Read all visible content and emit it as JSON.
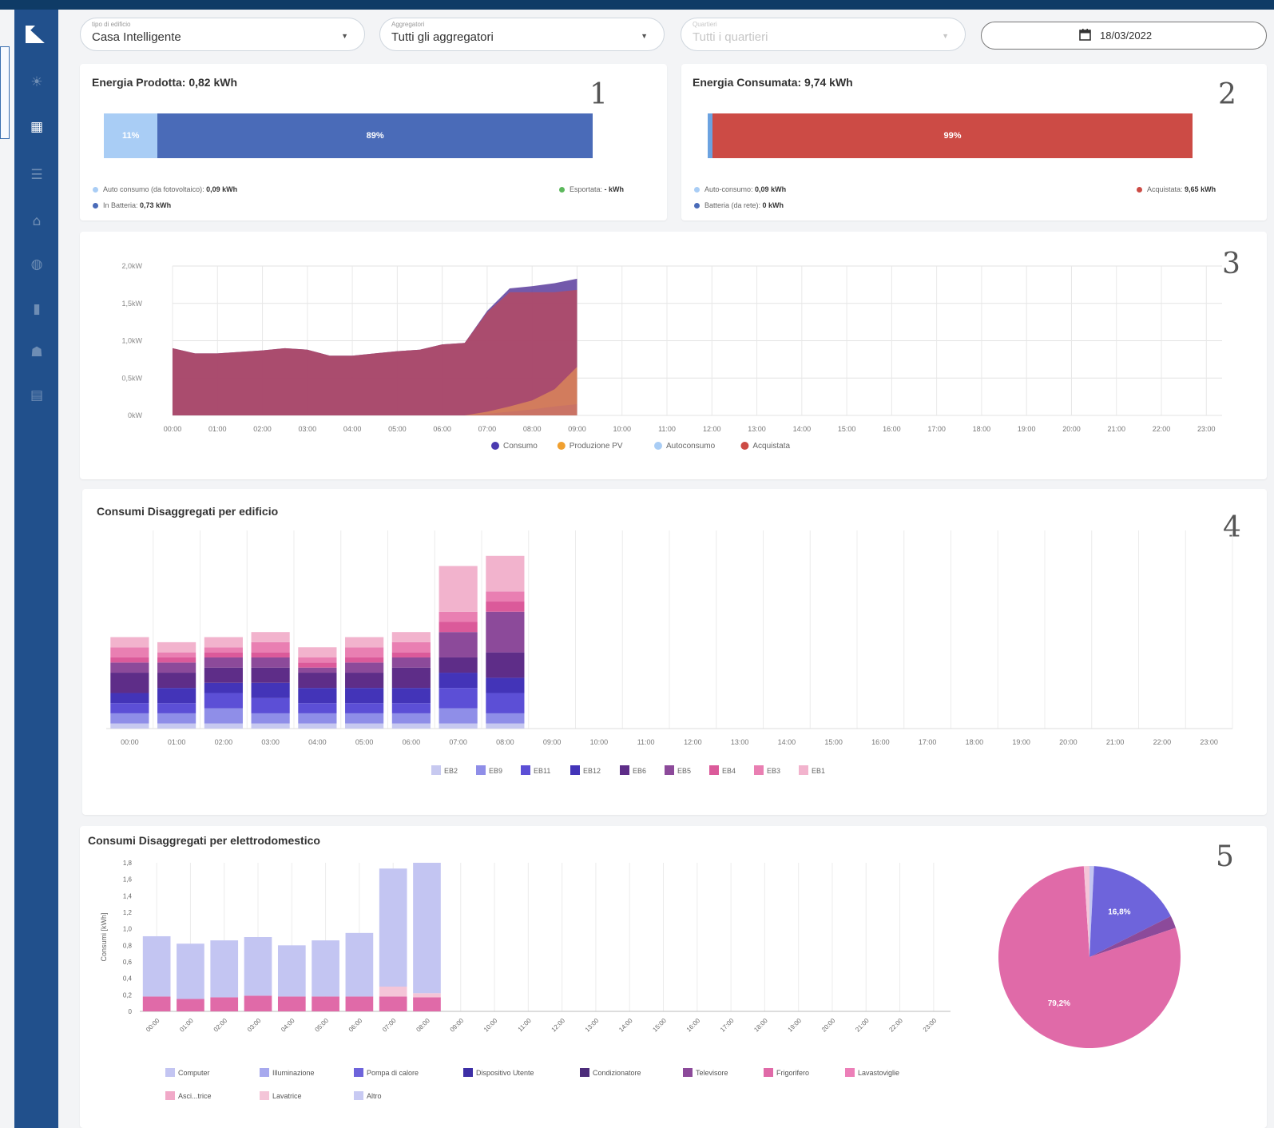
{
  "filters": {
    "building_type": {
      "label": "tipo di edificio",
      "value": "Casa Intelligente"
    },
    "aggregators": {
      "label": "Aggregatori",
      "value": "Tutti gli aggregatori"
    },
    "districts": {
      "label": "Quartieri",
      "value": "Tutti i quartieri"
    },
    "date": "18/03/2022"
  },
  "produced": {
    "title": "Energia Prodotta: 0,82 kWh",
    "number": "1",
    "bar": [
      {
        "label": "11%",
        "fraction": 0.11,
        "color": "#a9cdf5"
      },
      {
        "label": "89%",
        "fraction": 0.89,
        "color": "#4a6bb8"
      }
    ],
    "legend_self_label": "Auto consumo (da fotovoltaico):",
    "legend_self_value": "0,09 kWh",
    "legend_battery_label": "In Batteria:",
    "legend_battery_value": "0,73 kWh",
    "legend_exported_label": "Esportata:",
    "legend_exported_value": "- kWh",
    "colors": {
      "self": "#a9cdf5",
      "battery": "#4a6bb8",
      "exported": "#5cb85c"
    }
  },
  "consumed": {
    "title": "Energia Consumata: 9,74 kWh",
    "number": "2",
    "bar": [
      {
        "label": "",
        "fraction": 0.01,
        "color": "#6ba2e0"
      },
      {
        "label": "99%",
        "fraction": 0.99,
        "color": "#cc4b45"
      }
    ],
    "legend_self_label": "Auto-consumo:",
    "legend_self_value": "0,09 kWh",
    "legend_battery_label": "Batteria (da rete):",
    "legend_battery_value": "0 kWh",
    "legend_bought_label": "Acquistata:",
    "legend_bought_value": "9,65 kWh",
    "colors": {
      "self": "#a9cdf5",
      "battery": "#4a6bb8",
      "bought": "#cc4b45"
    }
  },
  "power_chart": {
    "number": "3",
    "chart_data": {
      "type": "area",
      "x": [
        "00:00",
        "01:00",
        "02:00",
        "03:00",
        "04:00",
        "05:00",
        "06:00",
        "07:00",
        "08:00",
        "09:00",
        "10:00",
        "11:00",
        "12:00",
        "13:00",
        "14:00",
        "15:00",
        "16:00",
        "17:00",
        "18:00",
        "19:00",
        "20:00",
        "21:00",
        "22:00",
        "23:00"
      ],
      "y_ticks": [
        "0kW",
        "0,5kW",
        "1,0kW",
        "1,5kW",
        "2,0kW"
      ],
      "ylim": [
        0,
        2.0
      ],
      "series": [
        {
          "name": "Consumo",
          "color": "#4b3bb0",
          "values": [
            0.9,
            0.83,
            0.83,
            0.85,
            0.87,
            0.9,
            0.88,
            0.8,
            0.8,
            0.83,
            0.86,
            0.88,
            0.95,
            0.97,
            1.4,
            1.7,
            1.73,
            1.77,
            1.83
          ]
        },
        {
          "name": "Produzione PV",
          "color": "#f0a030",
          "values": [
            0,
            0,
            0,
            0,
            0,
            0,
            0,
            0,
            0,
            0,
            0,
            0,
            0,
            0,
            0.05,
            0.12,
            0.2,
            0.35,
            0.65
          ]
        },
        {
          "name": "Autoconsumo",
          "color": "#a9cdf5",
          "values": [
            0,
            0,
            0,
            0,
            0,
            0,
            0,
            0,
            0,
            0,
            0,
            0,
            0,
            0,
            0.02,
            0.05,
            0.08,
            0.12,
            0.15
          ]
        },
        {
          "name": "Acquistata",
          "color": "#cc4b45",
          "values": [
            0.9,
            0.83,
            0.83,
            0.85,
            0.87,
            0.9,
            0.88,
            0.8,
            0.8,
            0.83,
            0.86,
            0.88,
            0.95,
            0.97,
            1.38,
            1.65,
            1.65,
            1.65,
            1.68
          ]
        }
      ],
      "x_step_hours": 0.5
    }
  },
  "buildings_chart": {
    "title": "Consumi Disaggregati per edificio",
    "number": "4",
    "chart_data": {
      "type": "bar",
      "categories": [
        "00:00",
        "01:00",
        "02:00",
        "03:00",
        "04:00",
        "05:00",
        "06:00",
        "07:00",
        "08:00",
        "09:00",
        "10:00",
        "11:00",
        "12:00",
        "13:00",
        "14:00",
        "15:00",
        "16:00",
        "17:00",
        "18:00",
        "19:00",
        "20:00",
        "21:00",
        "22:00",
        "23:00"
      ],
      "stacked": true,
      "series": [
        {
          "name": "EB2",
          "color": "#c7c9f0",
          "values": [
            0.05,
            0.05,
            0.05,
            0.05,
            0.05,
            0.05,
            0.05,
            0.05,
            0.05
          ]
        },
        {
          "name": "EB9",
          "color": "#8f8ee8",
          "values": [
            0.1,
            0.1,
            0.15,
            0.1,
            0.1,
            0.1,
            0.1,
            0.15,
            0.1
          ]
        },
        {
          "name": "EB11",
          "color": "#5c4fd6",
          "values": [
            0.1,
            0.1,
            0.15,
            0.15,
            0.1,
            0.1,
            0.1,
            0.2,
            0.2
          ]
        },
        {
          "name": "EB12",
          "color": "#4334b8",
          "values": [
            0.1,
            0.15,
            0.1,
            0.15,
            0.15,
            0.15,
            0.15,
            0.15,
            0.15
          ]
        },
        {
          "name": "EB6",
          "color": "#5e2d88",
          "values": [
            0.2,
            0.15,
            0.15,
            0.15,
            0.15,
            0.15,
            0.2,
            0.15,
            0.25
          ]
        },
        {
          "name": "EB5",
          "color": "#8c4a9a",
          "values": [
            0.1,
            0.1,
            0.1,
            0.1,
            0.05,
            0.1,
            0.1,
            0.25,
            0.4
          ]
        },
        {
          "name": "EB4",
          "color": "#db5a9a",
          "values": [
            0.05,
            0.05,
            0.05,
            0.05,
            0.05,
            0.05,
            0.05,
            0.1,
            0.1
          ]
        },
        {
          "name": "EB3",
          "color": "#e97fb2",
          "values": [
            0.1,
            0.05,
            0.05,
            0.1,
            0.05,
            0.1,
            0.1,
            0.1,
            0.1
          ]
        },
        {
          "name": "EB1",
          "color": "#f2b3cd",
          "values": [
            0.1,
            0.1,
            0.1,
            0.1,
            0.1,
            0.1,
            0.1,
            0.45,
            0.35
          ]
        }
      ]
    }
  },
  "appliances_chart": {
    "title": "Consumi Disaggregati per elettrodomestico",
    "number": "5",
    "chart_data": {
      "type": "bar",
      "ylabel": "Consumi [kWh]",
      "ylim": [
        0,
        1.8
      ],
      "y_ticks": [
        "0",
        "0,2",
        "0,4",
        "0,6",
        "0,8",
        "1,0",
        "1,2",
        "1,4",
        "1,6",
        "1,8"
      ],
      "categories": [
        "00:00",
        "01:00",
        "02:00",
        "03:00",
        "04:00",
        "05:00",
        "06:00",
        "07:00",
        "08:00",
        "09:00",
        "10:00",
        "11:00",
        "12:00",
        "13:00",
        "14:00",
        "15:00",
        "16:00",
        "17:00",
        "18:00",
        "19:00",
        "20:00",
        "21:00",
        "22:00",
        "23:00"
      ],
      "stacked": true,
      "series": [
        {
          "name": "Frigorifero",
          "color": "#e06aa8",
          "values": [
            0.18,
            0.15,
            0.17,
            0.19,
            0.18,
            0.18,
            0.18,
            0.18,
            0.17
          ]
        },
        {
          "name": "Lavatrice",
          "color": "#f4c5d8",
          "values": [
            0,
            0,
            0,
            0,
            0,
            0,
            0,
            0.12,
            0.05
          ]
        },
        {
          "name": "Computer",
          "color": "#c3c5f2",
          "values": [
            0.73,
            0.67,
            0.69,
            0.71,
            0.62,
            0.68,
            0.77,
            1.43,
            1.58
          ]
        }
      ],
      "legend": [
        {
          "name": "Computer",
          "color": "#c3c5f2"
        },
        {
          "name": "Illuminazione",
          "color": "#a7a9ee"
        },
        {
          "name": "Pompa di calore",
          "color": "#6e64db"
        },
        {
          "name": "Dispositivo Utente",
          "color": "#3d2fa6"
        },
        {
          "name": "Condizionatore",
          "color": "#4c2c7a"
        },
        {
          "name": "Televisore",
          "color": "#8c4a9a"
        },
        {
          "name": "Frigorifero",
          "color": "#e06aa8"
        },
        {
          "name": "Lavastoviglie",
          "color": "#ec7fb8"
        },
        {
          "name": "Asciugatrice",
          "color": "#f1a9c8"
        },
        {
          "name": "Lavatrice",
          "color": "#f4c5d8"
        },
        {
          "name": "Altro",
          "color": "#c8caf3"
        }
      ],
      "legend_visible_text": {
        "asciugatrice": "Asci...trice"
      }
    },
    "pie": {
      "type": "pie",
      "slices": [
        {
          "label": "",
          "value": 0.8,
          "color": "#c3c5f2"
        },
        {
          "label": "16,8%",
          "value": 16.8,
          "color": "#6e64db"
        },
        {
          "label": "",
          "value": 2.2,
          "color": "#8c4a9a"
        },
        {
          "label": "79,2%",
          "value": 79.2,
          "color": "#e06aa8"
        },
        {
          "label": "",
          "value": 1.0,
          "color": "#f4c5d8"
        }
      ]
    }
  }
}
